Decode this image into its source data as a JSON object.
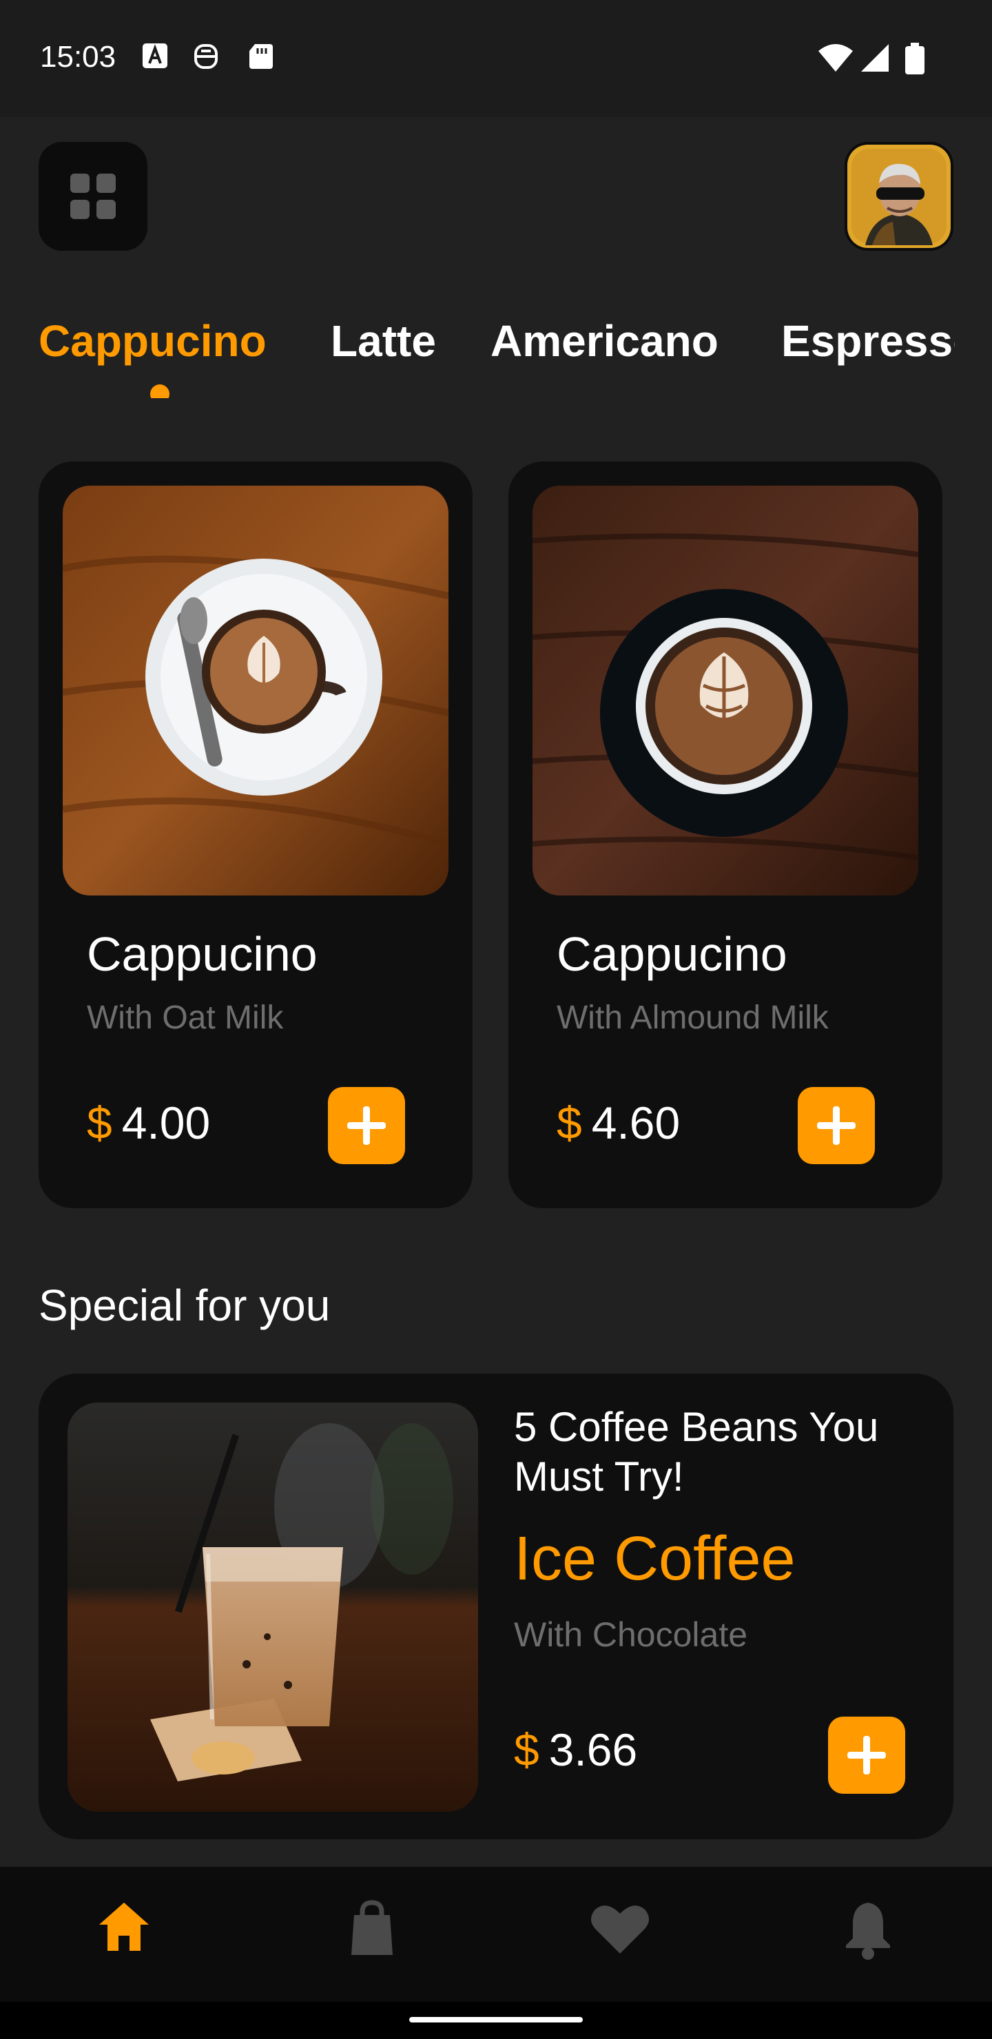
{
  "status_bar": {
    "time": "15:03"
  },
  "tabs": [
    {
      "label": "Cappucino",
      "active": true
    },
    {
      "label": "Latte",
      "active": false
    },
    {
      "label": "Americano",
      "active": false
    },
    {
      "label": "Espresso",
      "active": false
    }
  ],
  "products": [
    {
      "name": "Cappucino",
      "subtitle": "With Oat Milk",
      "currency": "$",
      "price": "4.00"
    },
    {
      "name": "Cappucino",
      "subtitle": "With Almound Milk",
      "currency": "$",
      "price": "4.60"
    }
  ],
  "special": {
    "section_title": "Special for you",
    "headline": "5 Coffee Beans You Must Try!",
    "name": "Ice Coffee",
    "subtitle": "With Chocolate",
    "currency": "$",
    "price": "3.66"
  },
  "bottom_nav": [
    {
      "icon": "home-icon",
      "active": true
    },
    {
      "icon": "shopping-bag-icon",
      "active": false
    },
    {
      "icon": "heart-icon",
      "active": false
    },
    {
      "icon": "bell-icon",
      "active": false
    }
  ],
  "colors": {
    "accent": "#ff9a00",
    "background": "#212121",
    "card": "#0f0f0f",
    "muted": "#6e6e6e"
  }
}
